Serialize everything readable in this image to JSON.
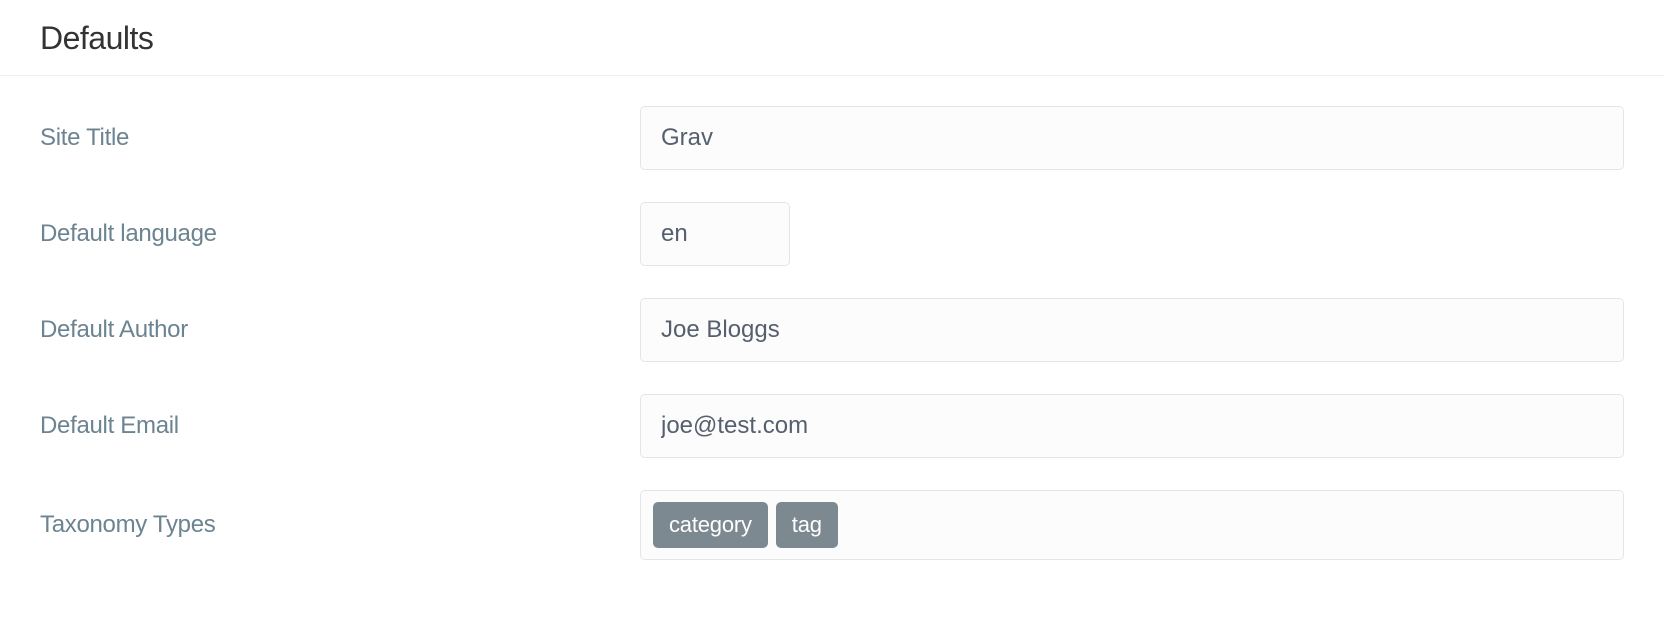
{
  "heading": "Defaults",
  "fields": {
    "site_title": {
      "label": "Site Title",
      "value": "Grav"
    },
    "default_language": {
      "label": "Default language",
      "value": "en"
    },
    "default_author": {
      "label": "Default Author",
      "value": "Joe Bloggs"
    },
    "default_email": {
      "label": "Default Email",
      "value": "joe@test.com"
    },
    "taxonomy": {
      "label": "Taxonomy Types",
      "tags": [
        "category",
        "tag"
      ]
    }
  }
}
